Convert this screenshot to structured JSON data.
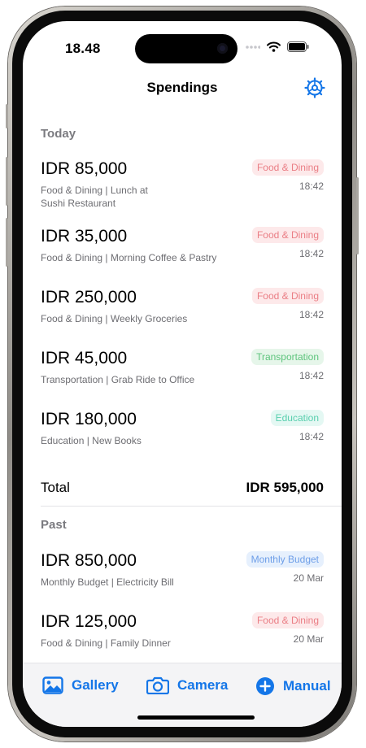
{
  "status": {
    "time": "18.48"
  },
  "header": {
    "title": "Spendings"
  },
  "today": {
    "heading": "Today",
    "items": [
      {
        "amount": "IDR 85,000",
        "desc": "Food & Dining | Lunch at Sushi Restaurant",
        "category": "Food & Dining",
        "time": "18:42"
      },
      {
        "amount": "IDR 35,000",
        "desc": "Food & Dining | Morning Coffee & Pastry",
        "category": "Food & Dining",
        "time": "18:42"
      },
      {
        "amount": "IDR 250,000",
        "desc": "Food & Dining | Weekly Groceries",
        "category": "Food & Dining",
        "time": "18:42"
      },
      {
        "amount": "IDR 45,000",
        "desc": "Transportation | Grab Ride to Office",
        "category": "Transportation",
        "time": "18:42"
      },
      {
        "amount": "IDR 180,000",
        "desc": "Education | New Books",
        "category": "Education",
        "time": "18:42"
      }
    ],
    "total_label": "Total",
    "total_value": "IDR 595,000"
  },
  "past": {
    "heading": "Past",
    "items": [
      {
        "amount": "IDR 850,000",
        "desc": "Monthly Budget | Electricity Bill",
        "category": "Monthly Budget",
        "time": "20 Mar"
      },
      {
        "amount": "IDR 125,000",
        "desc": "Food & Dining | Family Dinner",
        "category": "Food & Dining",
        "time": "20 Mar"
      }
    ]
  },
  "tabbar": {
    "gallery": "Gallery",
    "camera": "Camera",
    "manual": "Manual"
  },
  "colors": {
    "accent": "#1476e8",
    "food": "#ea7e85",
    "transportation": "#5ec47d",
    "education": "#59cfae",
    "budget": "#6d9ee8"
  },
  "icons": {
    "settings": "gear-icon",
    "gallery": "photo-icon",
    "camera": "camera-icon",
    "manual": "plus-circle-icon",
    "wifi": "wifi-icon",
    "battery": "battery-icon",
    "cellular": "cellular-icon"
  }
}
